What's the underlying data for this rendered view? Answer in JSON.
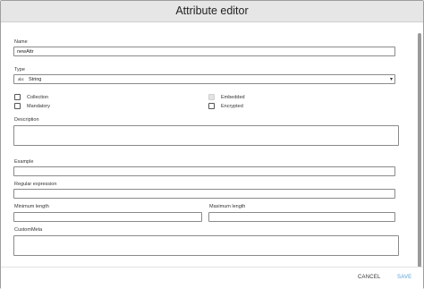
{
  "dialog": {
    "title": "Attribute editor",
    "close_symbol": "✕"
  },
  "form": {
    "name": {
      "label": "Name",
      "value": "newAttr"
    },
    "type": {
      "label": "Type",
      "value": "String",
      "icon": "abc-icon",
      "icon_text": "abc",
      "arrow": "▾"
    },
    "checkboxes": {
      "collection": {
        "label": "Collection",
        "checked": false
      },
      "embedded": {
        "label": "Embedded",
        "checked": false,
        "disabled": true
      },
      "mandatory": {
        "label": "Mandatory",
        "checked": false
      },
      "encrypted": {
        "label": "Encrypted",
        "checked": false
      }
    },
    "description": {
      "label": "Description",
      "value": ""
    },
    "example": {
      "label": "Example",
      "value": ""
    },
    "regex": {
      "label": "Regular expression",
      "value": ""
    },
    "min_length": {
      "label": "Minimum length",
      "value": ""
    },
    "max_length": {
      "label": "Maximum length",
      "value": ""
    },
    "custom_meta": {
      "label": "CustomMeta",
      "value": ""
    }
  },
  "footer": {
    "cancel_label": "CANCEL",
    "save_label": "SAVE"
  },
  "colors": {
    "titlebar": "#e6e6e6",
    "save_accent": "#5aa0d8"
  }
}
